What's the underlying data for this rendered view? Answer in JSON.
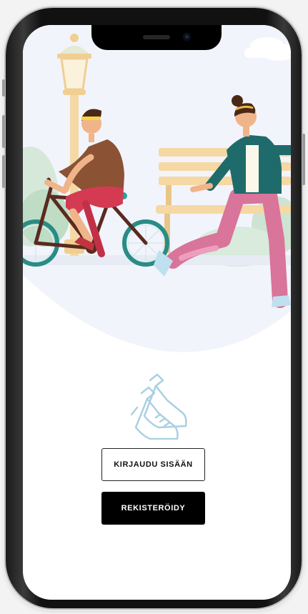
{
  "auth": {
    "login_label": "KIRJAUDU SISÄÄN",
    "register_label": "REKISTERÖIDY"
  },
  "colors": {
    "accent_teal": "#2a8c86",
    "logo_blue": "#a9d0e2",
    "button_primary": "#000000"
  },
  "icons": {
    "logo": "running-shoes-icon"
  }
}
